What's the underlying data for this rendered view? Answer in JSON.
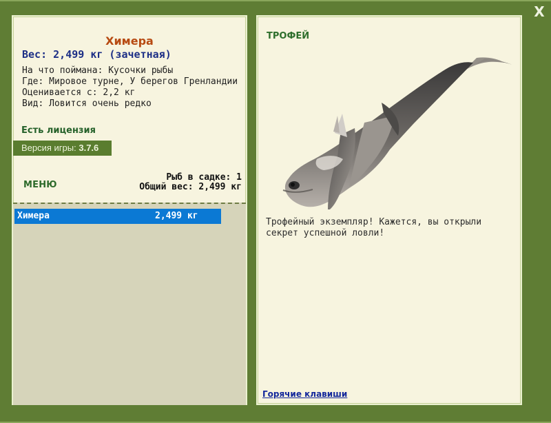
{
  "window": {
    "close_label": "X"
  },
  "fish": {
    "title": "Химера",
    "weight": "Вес: 2,499 кг (зачетная)",
    "details": [
      "На что поймана: Кусочки рыбы",
      "Где: Мировое турне, У берегов Гренландии",
      "Оценивается с: 2,2 кг",
      "Вид: Ловится очень редко"
    ]
  },
  "license": {
    "label": "Есть лицензия"
  },
  "version": {
    "label": "Версия игры: ",
    "value": "3.7.6"
  },
  "menu": {
    "label": "МЕНЮ"
  },
  "cage": {
    "count_label": "Рыб в садке: 1",
    "total_label": "Общий вес: 2,499 кг"
  },
  "list": {
    "rows": [
      {
        "name": "Химера",
        "weight": "2,499 кг"
      }
    ]
  },
  "trophy": {
    "label": "ТРОФЕЙ",
    "description": "Трофейный экземпляр! Кажется, вы открыли секрет успешной ловли!"
  },
  "hotkeys": {
    "label": "Горячие клавиши"
  },
  "colors": {
    "frame": "#5f7d34",
    "panel": "#f7f4df",
    "title": "#b74a12",
    "weight": "#1d2f86",
    "license": "#25612a",
    "selection": "#0b79d4",
    "link": "#13279b"
  }
}
